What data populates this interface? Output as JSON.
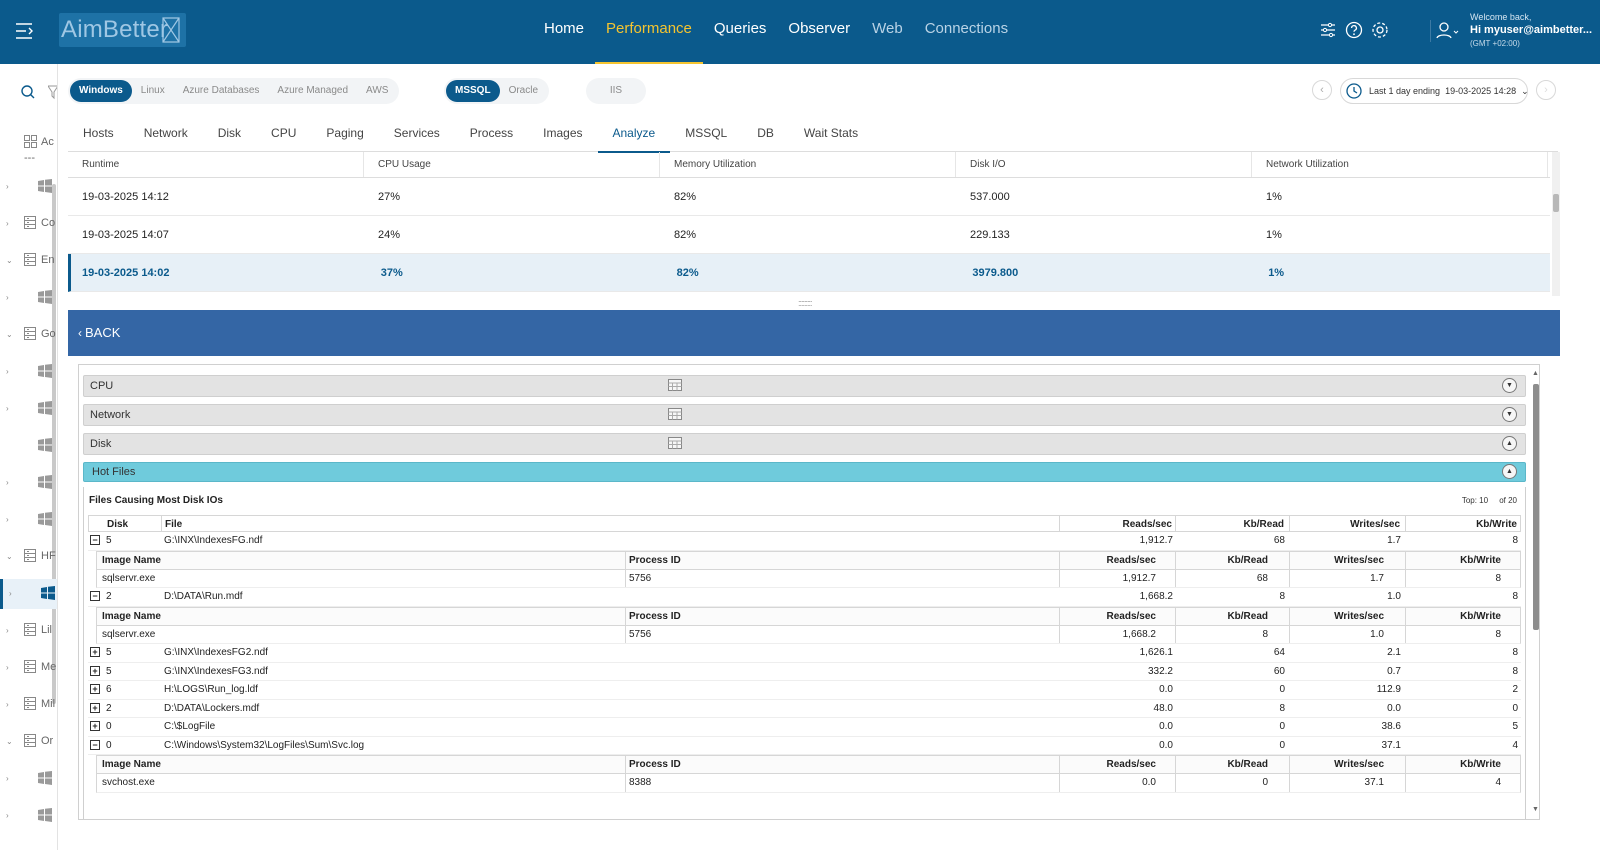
{
  "app": {
    "logo_text": "AimBetter"
  },
  "nav": {
    "items": [
      {
        "label": "Home",
        "state": "normal"
      },
      {
        "label": "Performance",
        "state": "active"
      },
      {
        "label": "Queries",
        "state": "normal"
      },
      {
        "label": "Observer",
        "state": "normal"
      },
      {
        "label": "Web",
        "state": "dim"
      },
      {
        "label": "Connections",
        "state": "dim"
      }
    ]
  },
  "user": {
    "welcome": "Welcome back,",
    "hi": "Hi myuser@aimbetter...",
    "tz": "(GMT +02:00)"
  },
  "sidebar": {
    "labels": [
      "Ac",
      "---",
      "",
      "Co",
      "En",
      "",
      "Go",
      "",
      "",
      "",
      "",
      "",
      "HF",
      "",
      "Lil",
      "Me",
      "Mil",
      "Or",
      "",
      ""
    ]
  },
  "filters": {
    "platforms": [
      "Windows",
      "Linux",
      "Azure Databases",
      "Azure Managed",
      "AWS"
    ],
    "db_types": [
      "MSSQL",
      "Oracle"
    ],
    "web": [
      "IIS"
    ],
    "time_label": "Last 1 day ending",
    "time_value": "19-03-2025 14:28"
  },
  "tabs": [
    "Hosts",
    "Network",
    "Disk",
    "CPU",
    "Paging",
    "Services",
    "Process",
    "Images",
    "Analyze",
    "MSSQL",
    "DB",
    "Wait Stats"
  ],
  "active_tab": "Analyze",
  "runtime_table": {
    "headers": [
      "Runtime",
      "CPU Usage",
      "Memory Utilization",
      "Disk I/O",
      "Network Utilization"
    ],
    "rows": [
      [
        "19-03-2025 14:12",
        "27%",
        "82%",
        "537.000",
        "1%"
      ],
      [
        "19-03-2025 14:07",
        "24%",
        "82%",
        "229.133",
        "1%"
      ],
      [
        "19-03-2025 14:02",
        "37%",
        "82%",
        "3979.800",
        "1%"
      ]
    ],
    "selected_row": 2
  },
  "back": {
    "label": "BACK"
  },
  "sections": {
    "cpu": "CPU",
    "network": "Network",
    "disk": "Disk",
    "hot": "Hot Files"
  },
  "hot_files": {
    "title": "Files Causing Most Disk IOs",
    "top_label": "Top:",
    "top_value": "10",
    "of_label": "of 20",
    "headers": {
      "disk": "Disk",
      "file": "File",
      "reads": "Reads/sec",
      "kbread": "Kb/Read",
      "writes": "Writes/sec",
      "kbwrite": "Kb/Write"
    },
    "sub_headers": {
      "image": "Image Name",
      "pid": "Process ID",
      "reads": "Reads/sec",
      "kbread": "Kb/Read",
      "writes": "Writes/sec",
      "kbwrite": "Kb/Write"
    },
    "rows": [
      {
        "exp": "−",
        "disk": "5",
        "file": "G:\\INX\\IndexesFG.ndf",
        "reads": "1,912.7",
        "kbread": "68",
        "writes": "1.7",
        "kbwrite": "8",
        "sub": {
          "image": "sqlservr.exe",
          "pid": "5756",
          "reads": "1,912.7",
          "kbread": "68",
          "writes": "1.7",
          "kbwrite": "8"
        }
      },
      {
        "exp": "−",
        "disk": "2",
        "file": "D:\\DATA\\Run.mdf",
        "reads": "1,668.2",
        "kbread": "8",
        "writes": "1.0",
        "kbwrite": "8",
        "sub": {
          "image": "sqlservr.exe",
          "pid": "5756",
          "reads": "1,668.2",
          "kbread": "8",
          "writes": "1.0",
          "kbwrite": "8"
        }
      },
      {
        "exp": "+",
        "disk": "5",
        "file": "G:\\INX\\IndexesFG2.ndf",
        "reads": "1,626.1",
        "kbread": "64",
        "writes": "2.1",
        "kbwrite": "8"
      },
      {
        "exp": "+",
        "disk": "5",
        "file": "G:\\INX\\IndexesFG3.ndf",
        "reads": "332.2",
        "kbread": "60",
        "writes": "0.7",
        "kbwrite": "8"
      },
      {
        "exp": "+",
        "disk": "6",
        "file": "H:\\LOGS\\Run_log.ldf",
        "reads": "0.0",
        "kbread": "0",
        "writes": "112.9",
        "kbwrite": "2"
      },
      {
        "exp": "+",
        "disk": "2",
        "file": "D:\\DATA\\Lockers.mdf",
        "reads": "48.0",
        "kbread": "8",
        "writes": "0.0",
        "kbwrite": "0"
      },
      {
        "exp": "+",
        "disk": "0",
        "file": "C:\\$LogFile",
        "reads": "0.0",
        "kbread": "0",
        "writes": "38.6",
        "kbwrite": "5"
      },
      {
        "exp": "−",
        "disk": "0",
        "file": "C:\\Windows\\System32\\LogFiles\\Sum\\Svc.log",
        "reads": "0.0",
        "kbread": "0",
        "writes": "37.1",
        "kbwrite": "4",
        "sub": {
          "image": "svchost.exe",
          "pid": "8388",
          "reads": "0.0",
          "kbread": "0",
          "writes": "37.1",
          "kbwrite": "4"
        }
      }
    ]
  },
  "colors": {
    "topbar": "#0b5a8c",
    "accent": "#f4c430",
    "back_bar": "#3466a5",
    "hot_files": "#6fcbdc"
  },
  "icons": [
    "menu-icon",
    "filter-icon",
    "help-icon",
    "settings-icon",
    "user-icon",
    "search-icon",
    "windows-icon",
    "server-icon",
    "clock-icon",
    "table-icon"
  ]
}
